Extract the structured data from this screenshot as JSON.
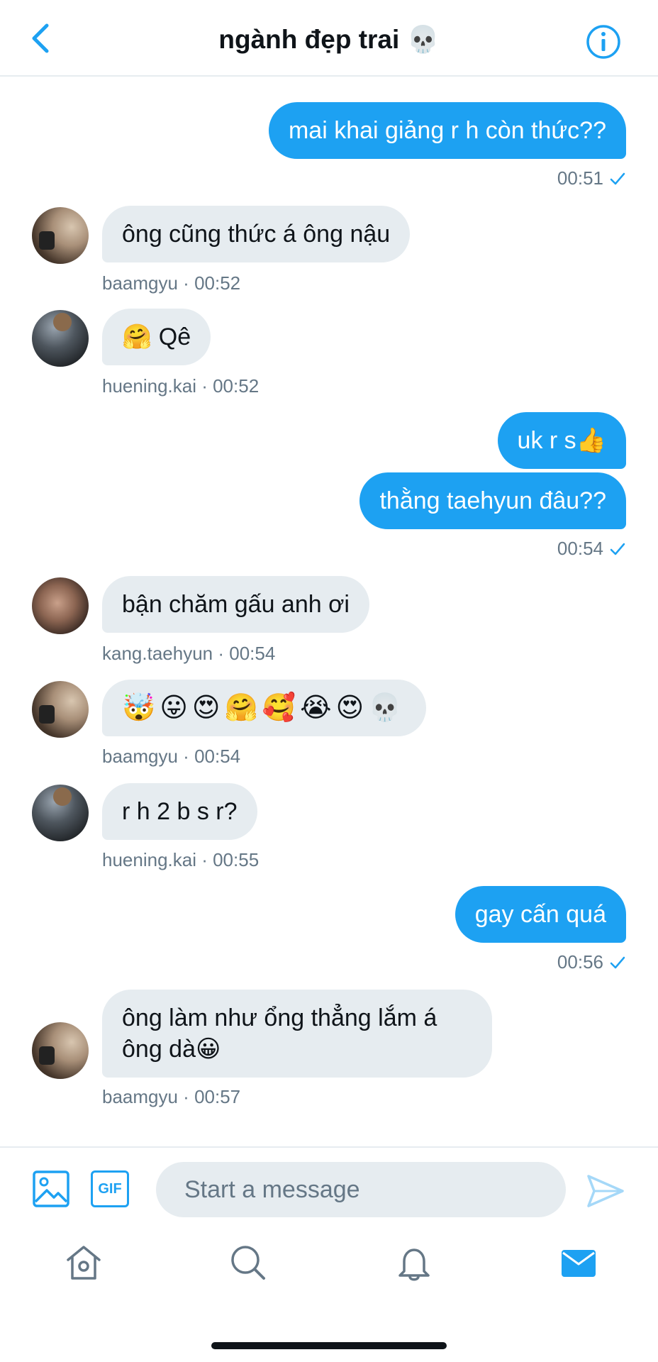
{
  "header": {
    "title": "ngành đẹp trai 💀",
    "back_icon": "chevron-left-icon",
    "info_icon": "info-icon",
    "accent_color": "#1da1f2"
  },
  "messages": [
    {
      "direction": "out",
      "text": "mai khai giảng r h còn thức??",
      "time": "00:51",
      "status": "sent-check"
    },
    {
      "direction": "in",
      "text": "ông cũng thức á ông nậu",
      "sender": "baamgyu",
      "time": "00:52",
      "meta": "baamgyu · 00:52"
    },
    {
      "direction": "in",
      "text": "🤗 Qê",
      "sender": "huening.kai",
      "time": "00:52",
      "meta": "huening.kai · 00:52"
    },
    {
      "direction": "out",
      "text": "uk r s👍"
    },
    {
      "direction": "out",
      "text": "thằng taehyun đâu??",
      "time": "00:54",
      "status": "sent-check"
    },
    {
      "direction": "in",
      "text": "bận chăm gấu anh ơi",
      "sender": "kang.taehyun",
      "time": "00:54",
      "meta": "kang.taehyun · 00:54"
    },
    {
      "direction": "in",
      "text": "🤯😛😍🤗🥰😭😍💀",
      "sender": "baamgyu",
      "time": "00:54",
      "meta": "baamgyu · 00:54"
    },
    {
      "direction": "in",
      "text": "r h 2 b s r?",
      "sender": "huening.kai",
      "time": "00:55",
      "meta": "huening.kai · 00:55"
    },
    {
      "direction": "out",
      "text": "gay cấn quá",
      "time": "00:56",
      "status": "sent-check"
    },
    {
      "direction": "in",
      "text": "ông làm như ổng thẳng lắm á ông dà😀",
      "sender": "baamgyu",
      "time": "00:57",
      "meta": "baamgyu · 00:57"
    }
  ],
  "composer": {
    "placeholder": "Start a message",
    "gif_label": "GIF",
    "image_icon": "image-icon",
    "send_icon": "send-icon"
  },
  "tabs": [
    {
      "name": "home-icon",
      "active": false
    },
    {
      "name": "search-icon",
      "active": false
    },
    {
      "name": "bell-icon",
      "active": false
    },
    {
      "name": "mail-icon",
      "active": true
    }
  ],
  "colors": {
    "outgoing_bubble": "#1da1f2",
    "incoming_bubble": "#e6ecf0",
    "meta_text": "#657786",
    "inactive_tab_icon": "#657786"
  }
}
